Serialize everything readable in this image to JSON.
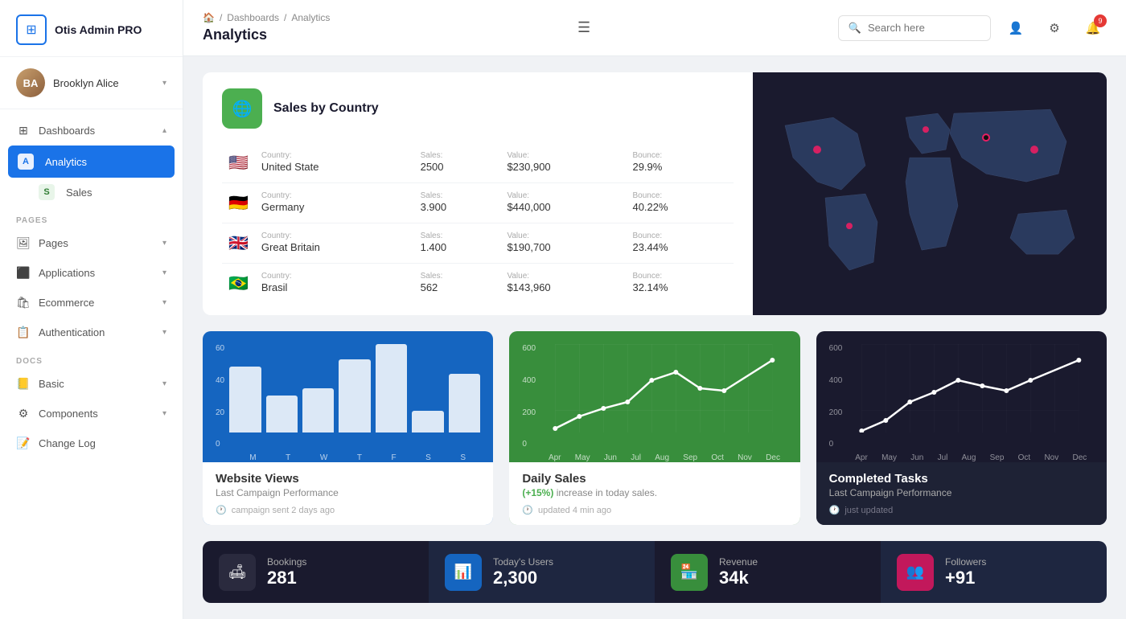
{
  "sidebar": {
    "logo": {
      "title": "Otis Admin PRO",
      "icon": "⊞"
    },
    "user": {
      "name": "Brooklyn Alice",
      "initials": "BA"
    },
    "nav": {
      "dashboards_label": "Dashboards",
      "analytics_label": "Analytics",
      "sales_label": "Sales",
      "sections": [
        {
          "title": "PAGES"
        },
        {
          "title": "DOCS"
        }
      ],
      "pages_items": [
        {
          "label": "Pages",
          "icon": "🖼"
        },
        {
          "label": "Applications",
          "icon": "⬛"
        },
        {
          "label": "Ecommerce",
          "icon": "🛍"
        },
        {
          "label": "Authentication",
          "icon": "📋"
        }
      ],
      "docs_items": [
        {
          "label": "Basic",
          "icon": "📒"
        },
        {
          "label": "Components",
          "icon": "⚙"
        },
        {
          "label": "Change Log",
          "icon": "📝"
        }
      ]
    }
  },
  "header": {
    "breadcrumb": [
      "🏠",
      "/",
      "Dashboards",
      "/",
      "Analytics"
    ],
    "title": "Analytics",
    "search_placeholder": "Search here",
    "notif_count": "9"
  },
  "sales_by_country": {
    "title": "Sales by Country",
    "icon": "🌐",
    "rows": [
      {
        "flag": "🇺🇸",
        "country_label": "Country:",
        "country": "United State",
        "sales_label": "Sales:",
        "sales": "2500",
        "value_label": "Value:",
        "value": "$230,900",
        "bounce_label": "Bounce:",
        "bounce": "29.9%"
      },
      {
        "flag": "🇩🇪",
        "country_label": "Country:",
        "country": "Germany",
        "sales_label": "Sales:",
        "sales": "3.900",
        "value_label": "Value:",
        "value": "$440,000",
        "bounce_label": "Bounce:",
        "bounce": "40.22%"
      },
      {
        "flag": "🇬🇧",
        "country_label": "Country:",
        "country": "Great Britain",
        "sales_label": "Sales:",
        "sales": "1.400",
        "value_label": "Value:",
        "value": "$190,700",
        "bounce_label": "Bounce:",
        "bounce": "23.44%"
      },
      {
        "flag": "🇧🇷",
        "country_label": "Country:",
        "country": "Brasil",
        "sales_label": "Sales:",
        "sales": "562",
        "value_label": "Value:",
        "value": "$143,960",
        "bounce_label": "Bounce:",
        "bounce": "32.14%"
      }
    ]
  },
  "charts": {
    "website_views": {
      "title": "Website Views",
      "subtitle": "Last Campaign Performance",
      "meta": "campaign sent 2 days ago",
      "x_labels": [
        "M",
        "T",
        "W",
        "T",
        "F",
        "S",
        "S"
      ],
      "y_labels": [
        "60",
        "40",
        "20",
        "0"
      ],
      "bars": [
        45,
        25,
        30,
        50,
        60,
        15,
        40
      ]
    },
    "daily_sales": {
      "title": "Daily Sales",
      "highlight": "(+15%)",
      "subtitle": "increase in today sales.",
      "meta": "updated 4 min ago",
      "x_labels": [
        "Apr",
        "May",
        "Jun",
        "Jul",
        "Aug",
        "Sep",
        "Oct",
        "Nov",
        "Dec"
      ],
      "y_labels": [
        "600",
        "400",
        "200",
        "0"
      ],
      "points": [
        10,
        80,
        140,
        200,
        380,
        460,
        260,
        220,
        520
      ]
    },
    "completed_tasks": {
      "title": "Completed Tasks",
      "subtitle": "Last Campaign Performance",
      "meta": "just updated",
      "x_labels": [
        "Apr",
        "May",
        "Jun",
        "Jul",
        "Aug",
        "Sep",
        "Oct",
        "Nov",
        "Dec"
      ],
      "y_labels": [
        "600",
        "400",
        "200",
        "0"
      ],
      "points": [
        20,
        60,
        200,
        280,
        380,
        320,
        280,
        380,
        500
      ]
    }
  },
  "stats": [
    {
      "icon": "🛋",
      "icon_class": "dark",
      "label": "Bookings",
      "value": "281"
    },
    {
      "icon": "📊",
      "icon_class": "blue",
      "label": "Today's Users",
      "value": "2,300"
    },
    {
      "icon": "🏪",
      "icon_class": "green",
      "label": "Revenue",
      "value": "34k"
    },
    {
      "icon": "👥",
      "icon_class": "pink",
      "label": "Followers",
      "value": "+91"
    }
  ]
}
